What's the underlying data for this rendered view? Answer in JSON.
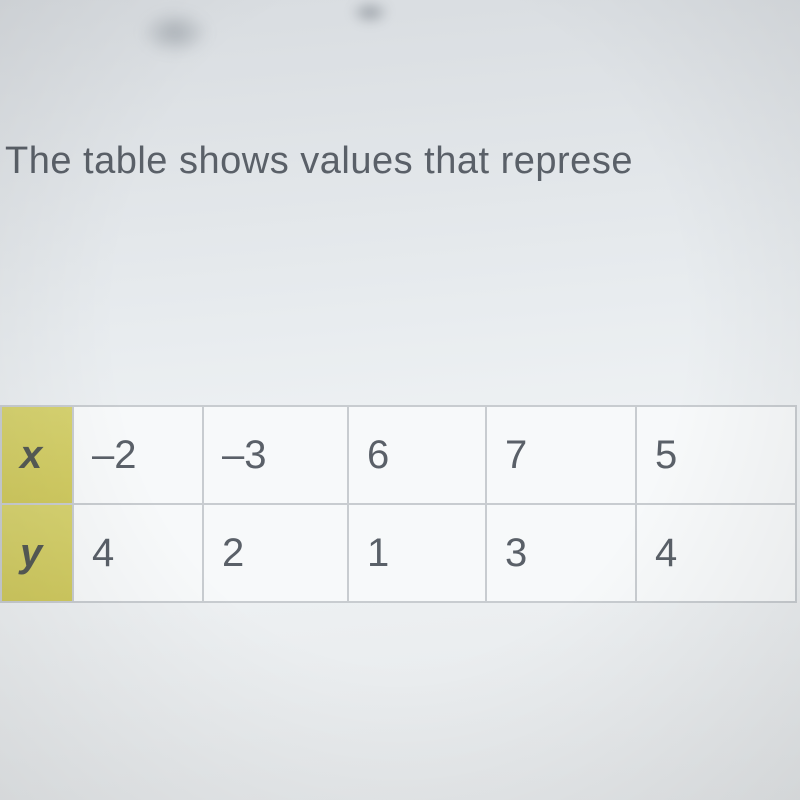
{
  "question": "The table shows values that represe",
  "chart_data": {
    "type": "table",
    "rows": [
      {
        "label": "x",
        "values": [
          "–2",
          "–3",
          "6",
          "7",
          "5"
        ]
      },
      {
        "label": "y",
        "values": [
          "4",
          "2",
          "1",
          "3",
          "4"
        ]
      }
    ]
  }
}
